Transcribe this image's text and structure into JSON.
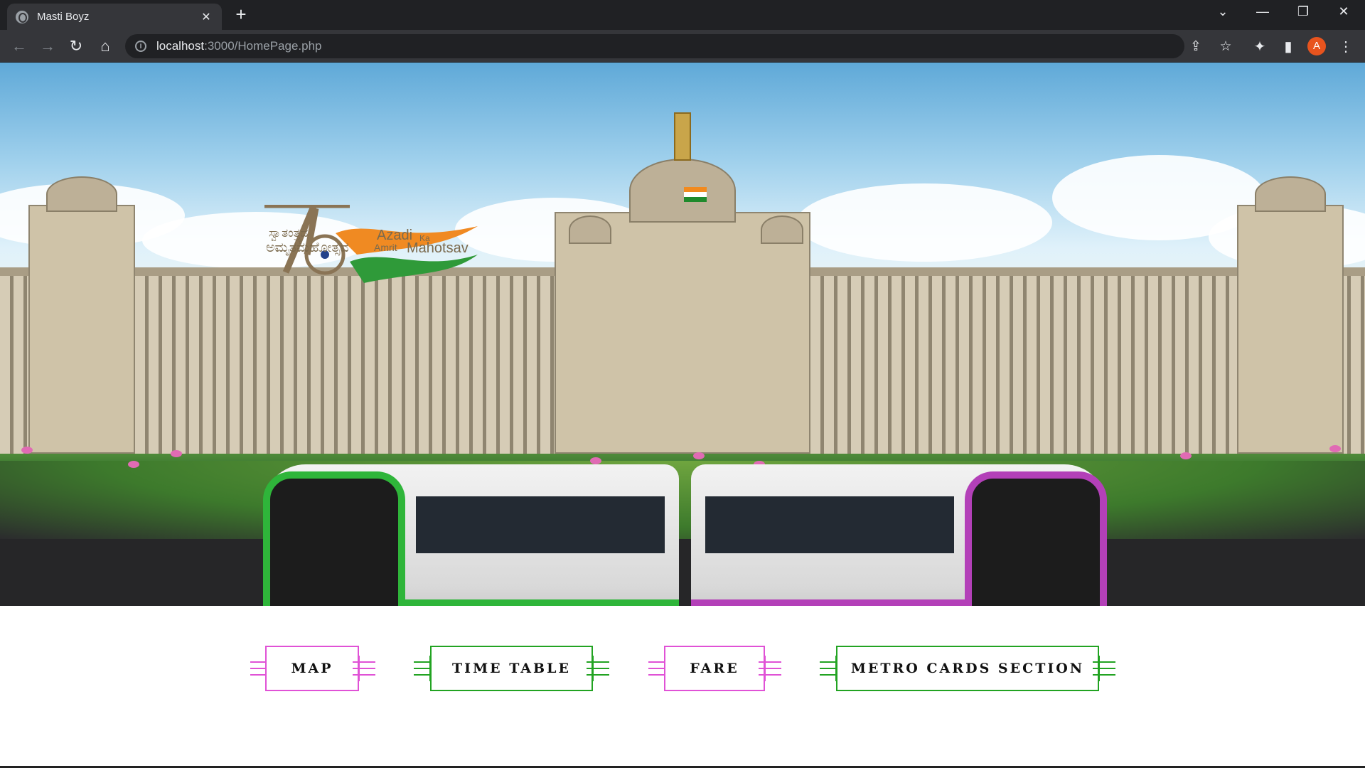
{
  "browser": {
    "tab_title": "Masti Boyz",
    "url_host": "localhost",
    "url_path": ":3000/HomePage.php",
    "profile_initial": "A"
  },
  "banner": {
    "logo_number": "75",
    "logo_kannada_line1": "ಸ್ವಾತಂತ್ರ್ಯದ",
    "logo_kannada_line2": "ಅಮೃತಮಹೋತ್ಸವ",
    "logo_azadi": "Azadi",
    "logo_ka": "Ka",
    "logo_amrit": "Amrit",
    "logo_mahotsav": "Mahotsav"
  },
  "nav_buttons": [
    {
      "label": "MAP",
      "color": "#e052d6"
    },
    {
      "label": "TIME TABLE",
      "color": "#22a322"
    },
    {
      "label": "FARE",
      "color": "#e052d6"
    },
    {
      "label": "METRO CARDS SECTION",
      "color": "#22a322"
    }
  ],
  "colors": {
    "pink_line": "#e052d6",
    "green_line": "#22a322",
    "chrome_dark": "#202124",
    "chrome_toolbar": "#35363a"
  }
}
